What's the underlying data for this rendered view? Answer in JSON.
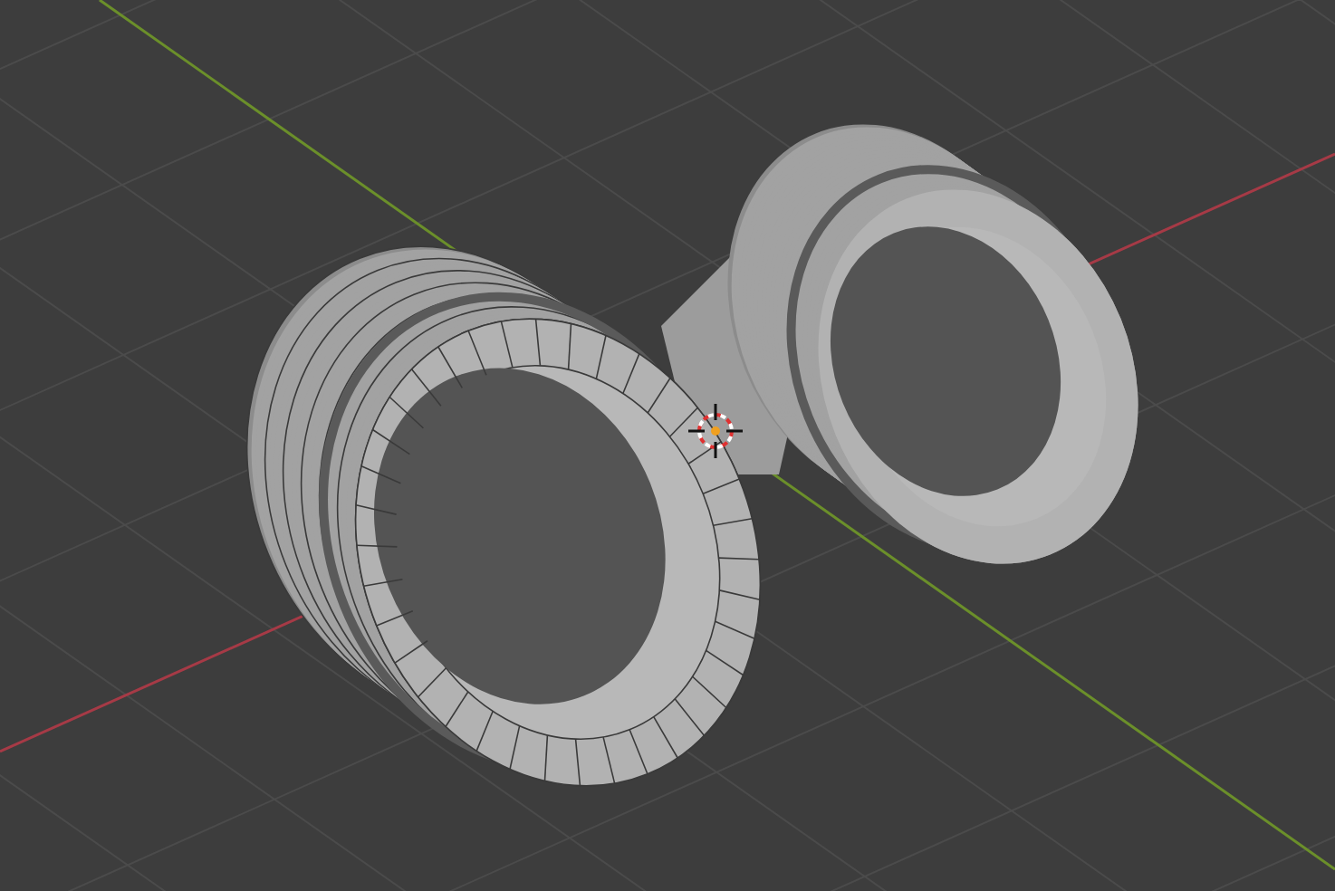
{
  "viewport": {
    "objects": [
      {
        "kind": "solid"
      },
      {
        "kind": "wireframe"
      }
    ]
  }
}
